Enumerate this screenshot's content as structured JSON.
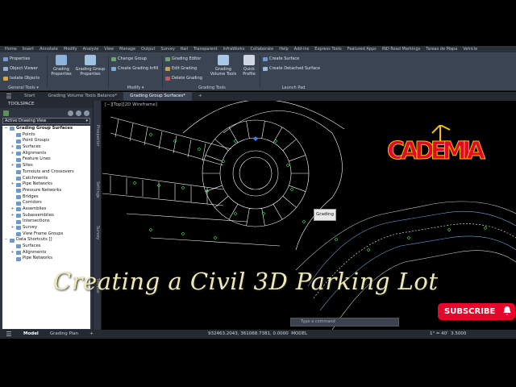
{
  "menu": [
    "Home",
    "Insert",
    "Annotate",
    "Modify",
    "Analyze",
    "View",
    "Manage",
    "Output",
    "Survey",
    "Rail",
    "Transparent",
    "InfraWorks",
    "Collaborate",
    "Help",
    "Add-ins",
    "Express Tools",
    "Featured Apps",
    "IND Road Markings",
    "Tareas de Mapa",
    "Vehicle"
  ],
  "ribbon": {
    "general_tools": {
      "title": "General Tools",
      "items": [
        "Properties",
        "Object Viewer",
        "Isolate Objects"
      ]
    },
    "grading_properties": "Grading Properties",
    "grading_group_properties": "Grading Group Properties",
    "modify": {
      "title": "Modify",
      "items": [
        "Change Group",
        "Create Grading Infill"
      ]
    },
    "grading_tools": {
      "title": "Grading Tools",
      "items": [
        "Grading Editor",
        "Edit Grading",
        "Delete Grading"
      ],
      "volume_tools": "Grading Volume Tools",
      "quick_profile": "Quick Profile"
    },
    "launch_pad": {
      "title": "Launch Pad",
      "items": [
        "Create Surface",
        "Create Detached Surface"
      ]
    }
  },
  "doc_tabs": [
    "Start",
    "Grading Volume Tools Balance*",
    "Grading Group Surfaces*"
  ],
  "active_tab": "Grading Group Surfaces*",
  "toolspace": {
    "title": "TOOLSPACE",
    "view": "Active Drawing View",
    "tree": [
      {
        "label": "Grading Group Surfaces",
        "root": true,
        "exp": "−"
      },
      {
        "label": "Points",
        "exp": ""
      },
      {
        "label": "Point Groups",
        "exp": ""
      },
      {
        "label": "Surfaces",
        "exp": "+"
      },
      {
        "label": "Alignments",
        "exp": "+"
      },
      {
        "label": "Feature Lines",
        "exp": ""
      },
      {
        "label": "Sites",
        "exp": "+"
      },
      {
        "label": "Turnouts and Crossovers",
        "exp": ""
      },
      {
        "label": "Catchments",
        "exp": ""
      },
      {
        "label": "Pipe Networks",
        "exp": "+"
      },
      {
        "label": "Pressure Networks",
        "exp": ""
      },
      {
        "label": "Bridges",
        "exp": ""
      },
      {
        "label": "Corridors",
        "exp": ""
      },
      {
        "label": "Assemblies",
        "exp": "+"
      },
      {
        "label": "Subassemblies",
        "exp": "+"
      },
      {
        "label": "Intersections",
        "exp": ""
      },
      {
        "label": "Survey",
        "exp": "+"
      },
      {
        "label": "View Frame Groups",
        "exp": ""
      },
      {
        "label": "Data Shortcuts []",
        "root": false,
        "exp": "−"
      },
      {
        "label": "Surfaces",
        "exp": ""
      },
      {
        "label": "Alignments",
        "exp": "+"
      },
      {
        "label": "Pipe Networks",
        "exp": ""
      }
    ]
  },
  "sidestrip": [
    "Prospector",
    "Settings",
    "Survey",
    "Toolbox"
  ],
  "viewport": {
    "label": "[−][Top][2D Wireframe]",
    "tooltip": "Grading"
  },
  "logo": "CADEMIA",
  "caption": "Creating a Civil 3D Parking Lot",
  "subscribe": "SUBSCRIBE",
  "command_placeholder": "Type a command",
  "status": {
    "tabs": [
      "Model",
      "Grading Plan"
    ],
    "coords": "932463.2043, 361068.7381, 0.0000",
    "space": "MODEL",
    "scale": "1\" = 40'",
    "zoom": "3.5000"
  },
  "colors": {
    "accent_red": "#e4062b",
    "logo_yellow": "#f2c200",
    "cad_white": "#ffffff"
  }
}
